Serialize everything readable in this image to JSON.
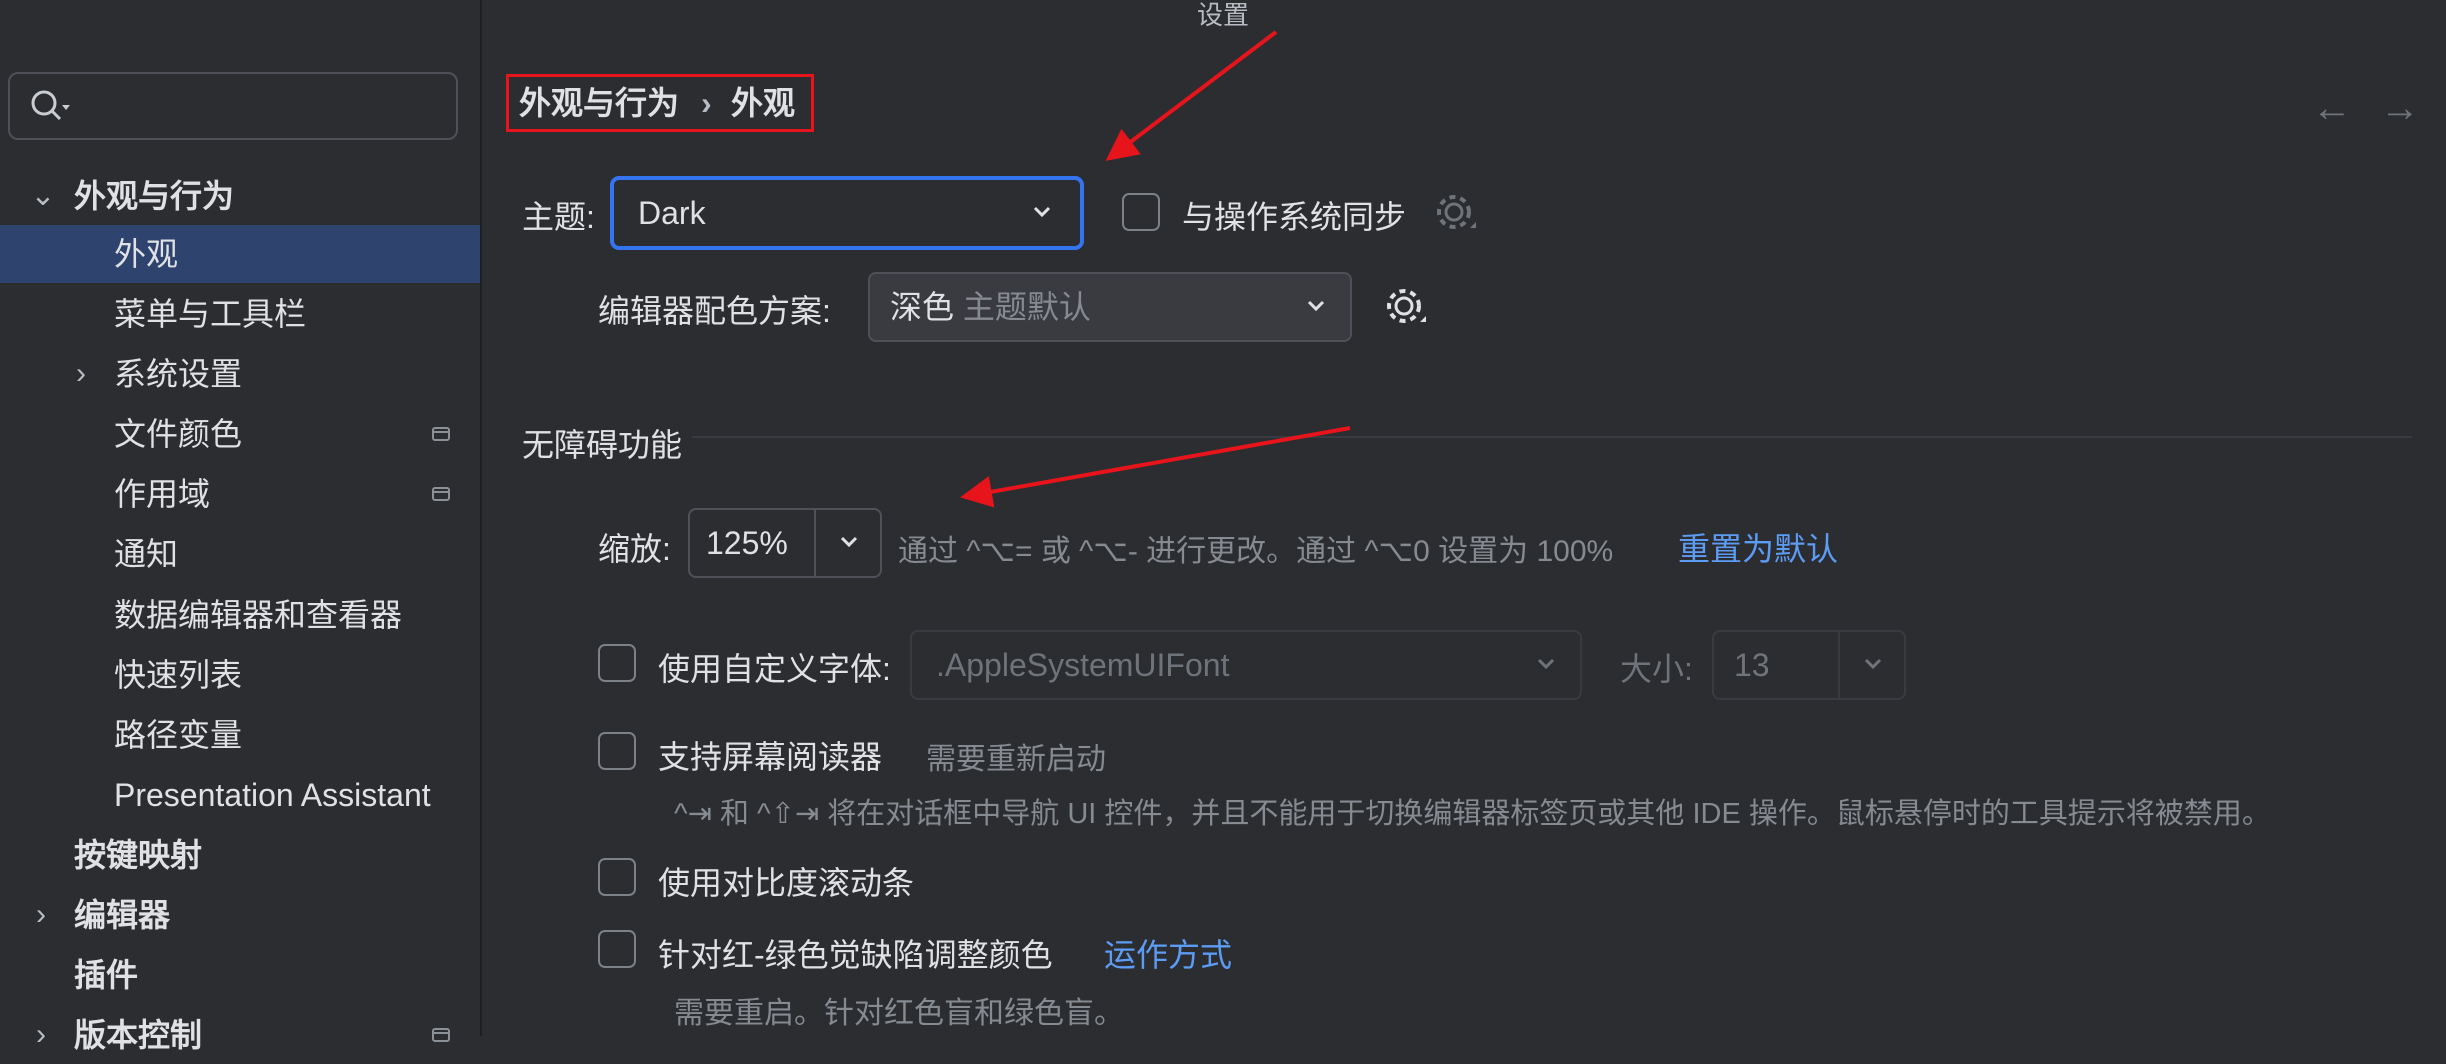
{
  "window": {
    "title": "设置",
    "traffic_colors": [
      "#ff5f57",
      "#4a4b4e",
      "#28c840"
    ]
  },
  "sidebar": {
    "search_placeholder": "",
    "items": [
      {
        "label": "外观与行为",
        "expanded": true,
        "bold": true
      },
      {
        "label": "外观",
        "selected": true
      },
      {
        "label": "菜单与工具栏"
      },
      {
        "label": "系统设置",
        "expandable": true
      },
      {
        "label": "文件颜色",
        "project_icon": true
      },
      {
        "label": "作用域",
        "project_icon": true
      },
      {
        "label": "通知"
      },
      {
        "label": "数据编辑器和查看器"
      },
      {
        "label": "快速列表"
      },
      {
        "label": "路径变量"
      },
      {
        "label": "Presentation Assistant"
      },
      {
        "label": "按键映射",
        "bold": true
      },
      {
        "label": "编辑器",
        "expandable": true,
        "bold": true
      },
      {
        "label": "插件",
        "bold": true
      },
      {
        "label": "版本控制",
        "expandable": true,
        "bold": true,
        "project_icon": true
      }
    ]
  },
  "breadcrumb": {
    "parent": "外观与行为",
    "separator": "›",
    "current": "外观"
  },
  "theme": {
    "label": "主题:",
    "value": "Dark",
    "sync_label": "与操作系统同步",
    "sync_checked": false
  },
  "editor_scheme": {
    "label": "编辑器配色方案:",
    "value": "深色",
    "hint": "主题默认"
  },
  "accessibility": {
    "section_title": "无障碍功能",
    "zoom_label": "缩放:",
    "zoom_value": "125%",
    "zoom_hint": "通过 ^⌥= 或 ^⌥- 进行更改。通过 ^⌥0 设置为 100%",
    "zoom_reset": "重置为默认",
    "custom_font_label": "使用自定义字体:",
    "custom_font_checked": false,
    "font_value": ".AppleSystemUIFont",
    "size_label": "大小:",
    "size_value": "13",
    "screen_reader_label": "支持屏幕阅读器",
    "screen_reader_checked": false,
    "screen_reader_note": "需要重新启动",
    "screen_reader_desc": "^⇥ 和 ^⇧⇥ 将在对话框中导航 UI 控件，并且不能用于切换编辑器标签页或其他 IDE 操作。鼠标悬停时的工具提示将被禁用。",
    "contrast_scrollbar_label": "使用对比度滚动条",
    "contrast_scrollbar_checked": false,
    "color_deficiency_label": "针对红-绿色觉缺陷调整颜色",
    "color_deficiency_checked": false,
    "color_deficiency_link": "运作方式",
    "color_deficiency_desc": "需要重启。针对红色盲和绿色盲。"
  },
  "nav": {
    "back": "←",
    "forward": "→"
  },
  "colors": {
    "accent_focus": "#3574f0",
    "selection": "#2e436e",
    "annotation_red": "#e8141c",
    "link": "#5d9cf5"
  }
}
